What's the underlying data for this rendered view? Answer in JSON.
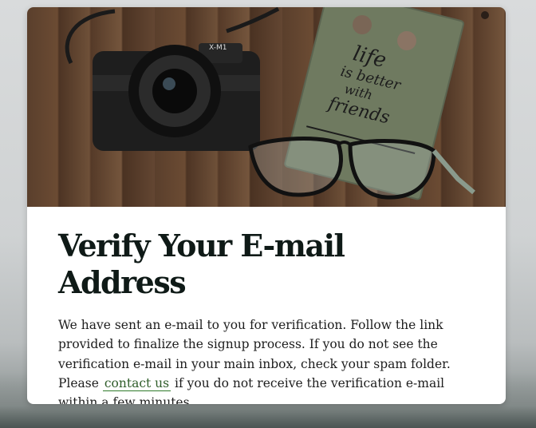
{
  "card": {
    "image_alt": "camera-glasses-notebook-photo",
    "notebook_text": [
      "life",
      "is better",
      "with",
      "friends"
    ],
    "camera_brand": "X-M1",
    "title": "Verify Your E-mail Address",
    "message_before_link": "We have sent an e-mail to you for verification. Follow the link provided to finalize the signup process. If you do not see the verification e-mail in your main inbox, check your spam folder. Please ",
    "link_label": "contact us",
    "message_after_link": " if you do not receive the verification e-mail within a few minutes."
  },
  "colors": {
    "title": "#0f1a17",
    "link": "#2f5d2a",
    "card_bg": "#ffffff"
  }
}
